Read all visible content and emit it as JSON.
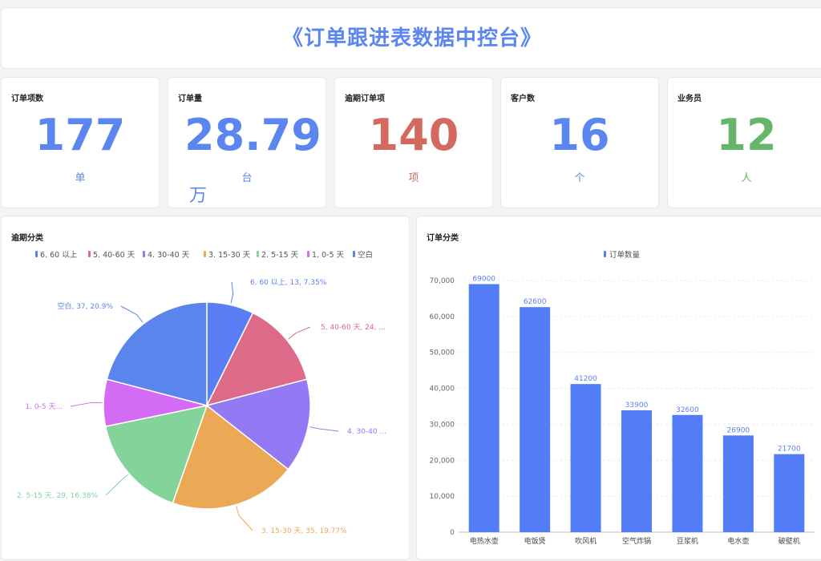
{
  "page": {
    "title": "《订单跟进表数据中控台》"
  },
  "colors": {
    "accent_blue": "#5b86f0",
    "red": "#d46a5f",
    "green": "#67b56b"
  },
  "kpis": [
    {
      "label": "订单项数",
      "value": "177",
      "unit": "单",
      "color": "#5b86f0"
    },
    {
      "label": "订单量",
      "value": "28.79",
      "inline_unit": "万",
      "unit": "台",
      "color": "#5b86f0"
    },
    {
      "label": "逾期订单项",
      "value": "140",
      "unit": "项",
      "color": "#d46a5f"
    },
    {
      "label": "客户数",
      "value": "16",
      "unit": "个",
      "color": "#5b86f0"
    },
    {
      "label": "业务员",
      "value": "12",
      "unit": "人",
      "color": "#67b56b"
    }
  ],
  "pie_panel": {
    "title": "逾期分类"
  },
  "bar_panel": {
    "title": "订单分类"
  },
  "chart_data": [
    {
      "type": "pie",
      "title": "逾期分类",
      "legend_position": "top",
      "slices": [
        {
          "name": "6. 60 以上",
          "value": 13,
          "percent": "7.35%",
          "color": "#5a7ff5",
          "label": "6. 60 以上, 13, 7.35%"
        },
        {
          "name": "5. 40-60 天",
          "value": 24,
          "percent": "13.56%",
          "color": "#dc6a88",
          "label": "5. 40-60 天, 24, ..."
        },
        {
          "name": "4. 30-40 天",
          "value": 26,
          "percent": "14.69%",
          "color": "#9479f5",
          "label": "4. 30-40 ..."
        },
        {
          "name": "3. 15-30 天",
          "value": 35,
          "percent": "19.77%",
          "color": "#eba955",
          "label": "3. 15-30 天, 35, 19.77%"
        },
        {
          "name": "2. 5-15 天",
          "value": 29,
          "percent": "16.38%",
          "color": "#83d39b",
          "label": "2. 5-15 天, 29, 16.38%"
        },
        {
          "name": "1. 0-5 天",
          "value": 13,
          "percent": "7.34%",
          "color": "#d36bf5",
          "label": "1. 0-5 天..."
        },
        {
          "name": "空白",
          "value": 37,
          "percent": "20.9%",
          "color": "#5b84ec",
          "label": "空白, 37, 20.9%"
        }
      ]
    },
    {
      "type": "bar",
      "title": "订单分类",
      "legend_position": "top",
      "series": [
        {
          "name": "订单数量",
          "color": "#537df7"
        }
      ],
      "categories": [
        "电热水壶",
        "电饭煲",
        "吹风机",
        "空气炸锅",
        "豆浆机",
        "电水壶",
        "破壁机"
      ],
      "values": [
        69000,
        62600,
        41200,
        33900,
        32600,
        26900,
        21700
      ],
      "ylim": [
        0,
        70000
      ],
      "yticks": [
        "0",
        "10,000",
        "20,000",
        "30,000",
        "40,000",
        "50,000",
        "60,000",
        "70,000"
      ],
      "grid": true
    }
  ]
}
